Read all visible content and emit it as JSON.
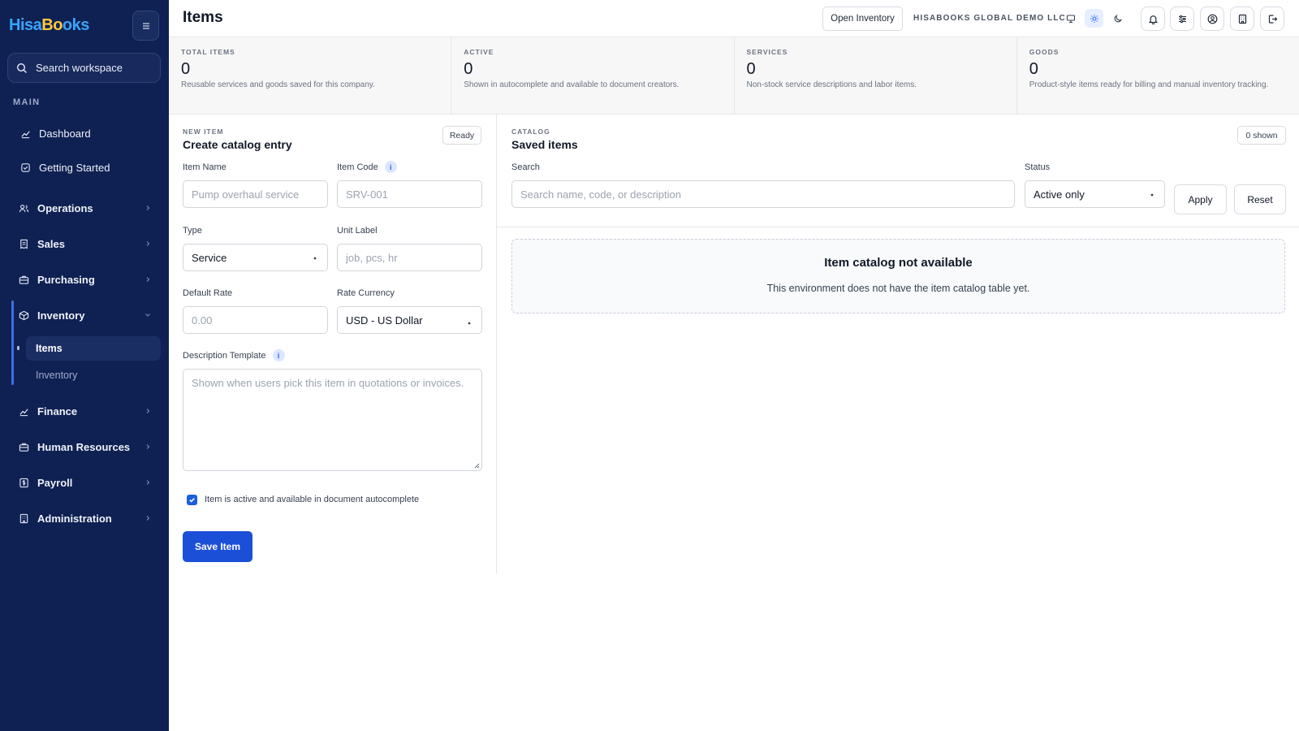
{
  "brand": {
    "part1": "Hisa",
    "part2": "Bo",
    "part3": "oks"
  },
  "sidebar": {
    "search_label": "Search workspace",
    "section_label": "MAIN",
    "items": [
      {
        "label": "Dashboard",
        "icon": "chart-icon"
      },
      {
        "label": "Getting Started",
        "icon": "checklist-icon"
      },
      {
        "label": "Operations",
        "icon": "users-icon"
      },
      {
        "label": "Sales",
        "icon": "receipt-icon"
      },
      {
        "label": "Purchasing",
        "icon": "briefcase-icon"
      },
      {
        "label": "Inventory",
        "icon": "box-icon"
      },
      {
        "label": "Finance",
        "icon": "chart-icon"
      },
      {
        "label": "Human Resources",
        "icon": "briefcase-icon"
      },
      {
        "label": "Payroll",
        "icon": "dollar-icon"
      },
      {
        "label": "Administration",
        "icon": "building-icon"
      }
    ],
    "inventory_sub": [
      "Items",
      "Inventory"
    ]
  },
  "header": {
    "title": "Items",
    "open_inventory": "Open Inventory",
    "company": "HISABOOKS GLOBAL DEMO LLC"
  },
  "stats": [
    {
      "label": "TOTAL ITEMS",
      "value": "0",
      "desc": "Reusable services and goods saved for this company."
    },
    {
      "label": "ACTIVE",
      "value": "0",
      "desc": "Shown in autocomplete and available to document creators."
    },
    {
      "label": "SERVICES",
      "value": "0",
      "desc": "Non-stock service descriptions and labor items."
    },
    {
      "label": "GOODS",
      "value": "0",
      "desc": "Product-style items ready for billing and manual inventory tracking."
    }
  ],
  "form": {
    "kicker": "NEW ITEM",
    "title": "Create catalog entry",
    "status": "Ready",
    "item_name_label": "Item Name",
    "item_name_placeholder": "Pump overhaul service",
    "item_code_label": "Item Code",
    "item_code_placeholder": "SRV-001",
    "type_label": "Type",
    "type_value": "Service",
    "unit_label": "Unit Label",
    "unit_placeholder": "job, pcs, hr",
    "rate_label": "Default Rate",
    "rate_placeholder": "0.00",
    "currency_label": "Rate Currency",
    "currency_value": "USD - US Dollar",
    "desc_label": "Description Template",
    "desc_placeholder": "Shown when users pick this item in quotations or invoices.",
    "active_checkbox_label": "Item is active and available in document autocomplete",
    "active_checked": true,
    "save_label": "Save Item",
    "info_glyph": "i"
  },
  "catalog": {
    "kicker": "CATALOG",
    "title": "Saved items",
    "shown": "0 shown",
    "search_label": "Search",
    "search_placeholder": "Search name, code, or description",
    "status_label": "Status",
    "status_value": "Active only",
    "apply_label": "Apply",
    "reset_label": "Reset",
    "empty_title": "Item catalog not available",
    "empty_text": "This environment does not have the item catalog table yet."
  },
  "colors": {
    "sidebar_bg": "#0f2152",
    "accent": "#1c4fd8",
    "brand_blue": "#3aa4ff",
    "brand_yellow": "#ffc83d"
  }
}
